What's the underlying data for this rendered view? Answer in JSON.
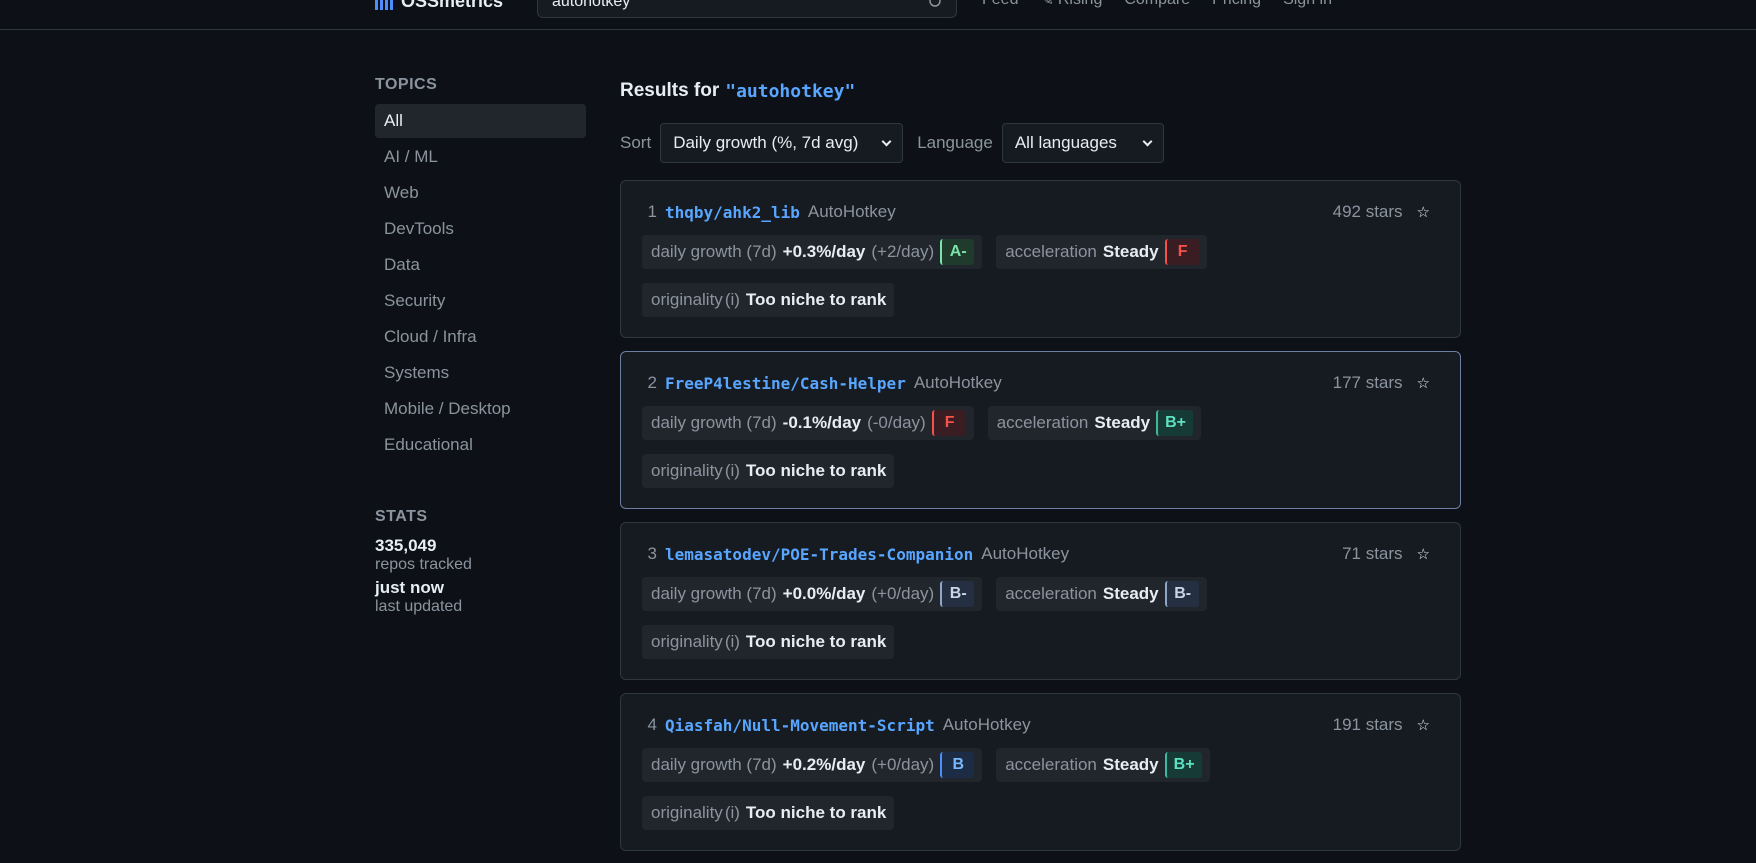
{
  "header": {
    "brand": "OSSmetrics",
    "search_value": "autohotkey",
    "nav": [
      "Feed",
      "Rising",
      "Compare",
      "Pricing",
      "Sign in"
    ]
  },
  "sidebar": {
    "topics_heading": "TOPICS",
    "topics": [
      "All",
      "AI / ML",
      "Web",
      "DevTools",
      "Data",
      "Security",
      "Cloud / Infra",
      "Systems",
      "Mobile / Desktop",
      "Educational"
    ],
    "active_topic": "All",
    "stats_heading": "STATS",
    "repos_count": "335,049",
    "repos_label": "repos tracked",
    "updated_value": "just now",
    "updated_label": "last updated"
  },
  "main": {
    "results_prefix": "Results for",
    "query": "\"autohotkey\"",
    "sort_label": "Sort",
    "sort_value": "Daily growth (%, 7d avg)",
    "language_label": "Language",
    "language_value": "All languages",
    "growth_label": "daily growth (7d)",
    "accel_label": "acceleration",
    "orig_label": "originality",
    "orig_info": "(i)",
    "results": [
      {
        "rank": "1",
        "repo": "thqby/ahk2_lib",
        "lang": "AutoHotkey",
        "stars": "492 stars",
        "growth": "+0.3%/day",
        "abs": "(+2/day)",
        "growth_grade": "A-",
        "accel": "Steady",
        "accel_grade": "F",
        "orig": "Too niche to rank"
      },
      {
        "rank": "2",
        "repo": "FreeP4lestine/Cash-Helper",
        "lang": "AutoHotkey",
        "stars": "177 stars",
        "growth": "-0.1%/day",
        "abs": "(-0/day)",
        "growth_grade": "F",
        "accel": "Steady",
        "accel_grade": "B+",
        "orig": "Too niche to rank"
      },
      {
        "rank": "3",
        "repo": "lemasatodev/POE-Trades-Companion",
        "lang": "AutoHotkey",
        "stars": "71 stars",
        "growth": "+0.0%/day",
        "abs": "(+0/day)",
        "growth_grade": "B-",
        "accel": "Steady",
        "accel_grade": "B-",
        "orig": "Too niche to rank"
      },
      {
        "rank": "4",
        "repo": "Qiasfah/Null-Movement-Script",
        "lang": "AutoHotkey",
        "stars": "191 stars",
        "growth": "+0.2%/day",
        "abs": "(+0/day)",
        "growth_grade": "B",
        "accel": "Steady",
        "accel_grade": "B+",
        "orig": "Too niche to rank"
      }
    ]
  },
  "colors": {
    "accent": "#58a6ff",
    "background": "#0d1117",
    "card": "#161b22"
  }
}
